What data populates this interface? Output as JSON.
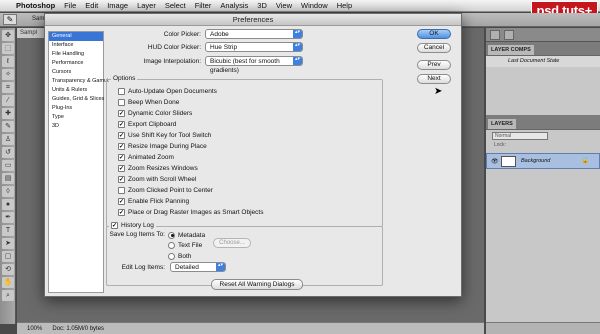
{
  "menubar": {
    "apple": "",
    "items": [
      "Photoshop",
      "File",
      "Edit",
      "Image",
      "Layer",
      "Select",
      "Filter",
      "Analysis",
      "3D",
      "View",
      "Window",
      "Help"
    ]
  },
  "logo": "psd tuts+",
  "options_bar": {
    "label": "Sampl"
  },
  "document": {
    "tab": "Sampl",
    "zoom": "100%",
    "doc_info": "Doc: 1.05M/0 bytes"
  },
  "panels": {
    "layer_comps": {
      "tab": "LAYER COMPS",
      "row": "Last Document State"
    },
    "layers": {
      "tab": "LAYERS",
      "blend_mode": "Normal",
      "lock_label": "Lock:",
      "layer_name": "Background",
      "eye": "👁",
      "lock_icon": "🔒"
    }
  },
  "dialog": {
    "title": "Preferences",
    "categories": [
      {
        "label": "General",
        "selected": true
      },
      {
        "label": "Interface",
        "selected": false
      },
      {
        "label": "File Handling",
        "selected": false
      },
      {
        "label": "Performance",
        "selected": false
      },
      {
        "label": "Cursors",
        "selected": false
      },
      {
        "label": "Transparency & Gamut",
        "selected": false
      },
      {
        "label": "Units & Rulers",
        "selected": false
      },
      {
        "label": "Guides, Grid & Slices",
        "selected": false
      },
      {
        "label": "Plug-Ins",
        "selected": false
      },
      {
        "label": "Type",
        "selected": false
      },
      {
        "label": "3D",
        "selected": false
      }
    ],
    "color_picker": {
      "label": "Color Picker:",
      "value": "Adobe"
    },
    "hud_color_picker": {
      "label": "HUD Color Picker:",
      "value": "Hue Strip"
    },
    "image_interpolation": {
      "label": "Image Interpolation:",
      "value": "Bicubic (best for smooth gradients)"
    },
    "options": {
      "legend": "Options",
      "checkboxes": [
        {
          "label": "Auto-Update Open Documents",
          "checked": false
        },
        {
          "label": "Beep When Done",
          "checked": false
        },
        {
          "label": "Dynamic Color Sliders",
          "checked": true
        },
        {
          "label": "Export Clipboard",
          "checked": true
        },
        {
          "label": "Use Shift Key for Tool Switch",
          "checked": true
        },
        {
          "label": "Resize Image During Place",
          "checked": true
        },
        {
          "label": "Animated Zoom",
          "checked": true
        },
        {
          "label": "Zoom Resizes Windows",
          "checked": true
        },
        {
          "label": "Zoom with Scroll Wheel",
          "checked": true
        },
        {
          "label": "Zoom Clicked Point to Center",
          "checked": false
        },
        {
          "label": "Enable Flick Panning",
          "checked": true
        },
        {
          "label": "Place or Drag Raster Images as Smart Objects",
          "checked": true
        }
      ]
    },
    "history_log": {
      "label": "History Log",
      "checked": true,
      "save_label": "Save Log Items To:",
      "radios": [
        {
          "label": "Metadata",
          "selected": true
        },
        {
          "label": "Text File",
          "selected": false
        },
        {
          "label": "Both",
          "selected": false
        }
      ],
      "choose_button": "Choose...",
      "edit_label": "Edit Log Items:",
      "edit_value": "Detailed"
    },
    "reset_button": "Reset All Warning Dialogs",
    "buttons": {
      "ok": "OK",
      "cancel": "Cancel",
      "prev": "Prev",
      "next": "Next"
    },
    "checkmark": "✓",
    "popup_arrows": "▴▾"
  }
}
